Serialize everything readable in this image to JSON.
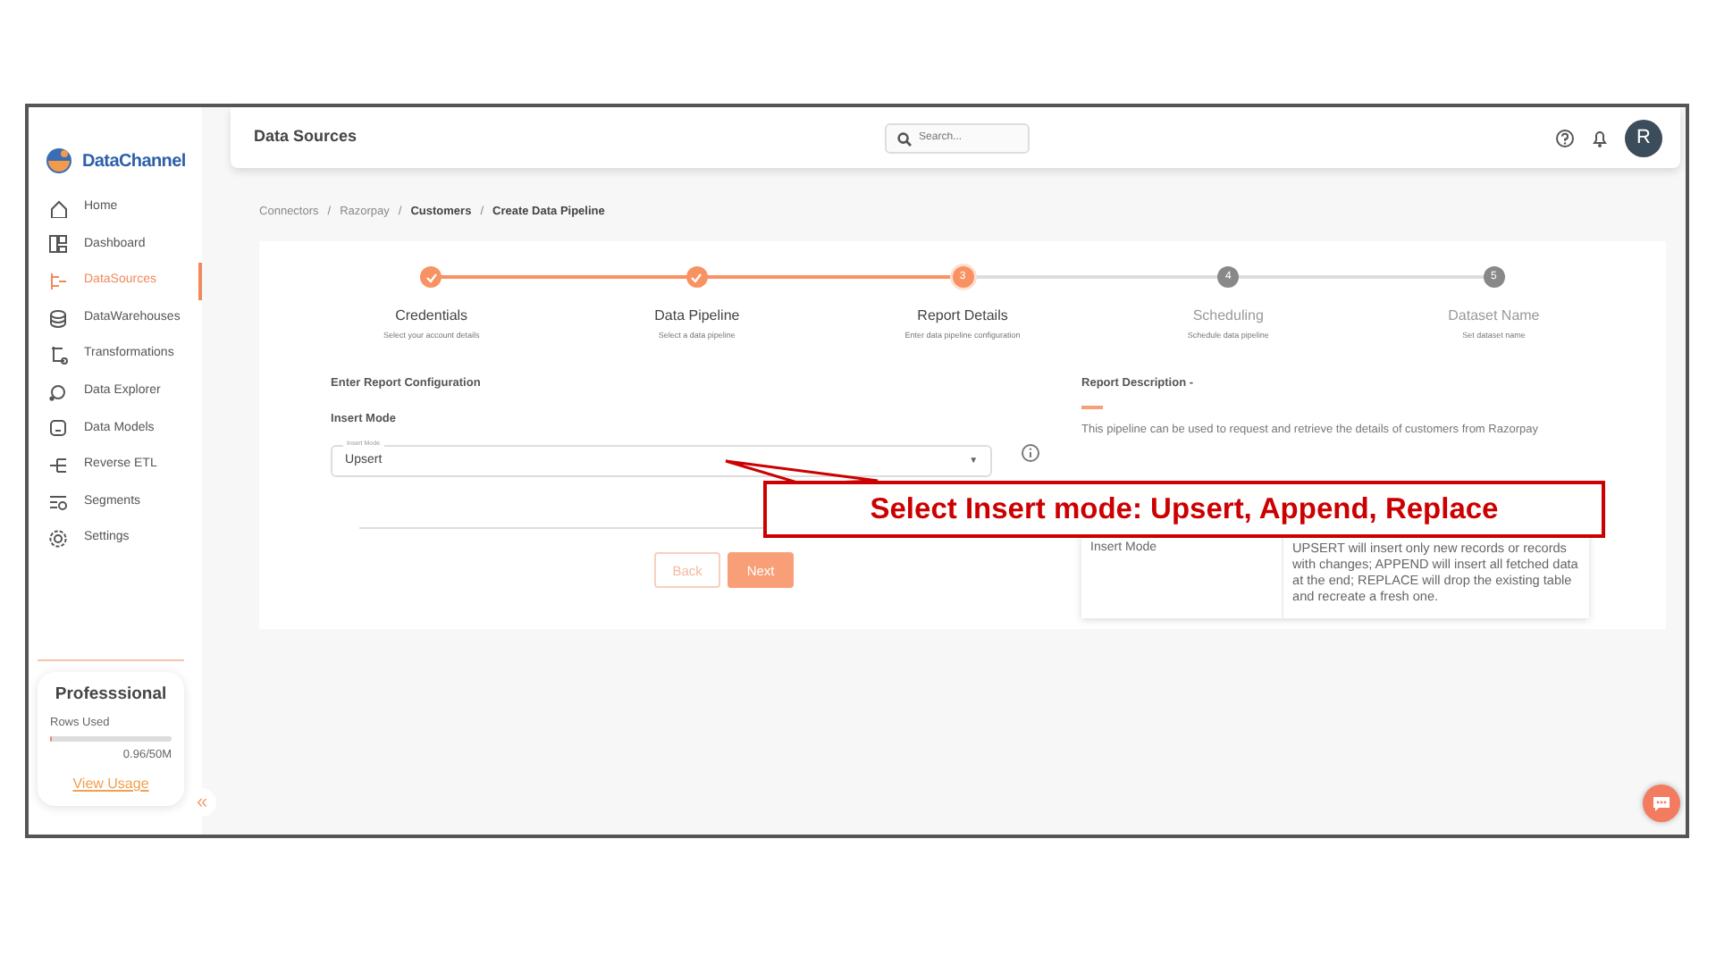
{
  "app": {
    "logo": "DataChannel"
  },
  "sidebar": {
    "items": [
      {
        "label": "Home",
        "selected": false
      },
      {
        "label": "Dashboard",
        "selected": false
      },
      {
        "label": "DataSources",
        "selected": true
      },
      {
        "label": "DataWarehouses",
        "selected": false
      },
      {
        "label": "Transformations",
        "selected": false
      },
      {
        "label": "Data Explorer",
        "selected": false
      },
      {
        "label": "Data Models",
        "selected": false
      },
      {
        "label": "Reverse ETL",
        "selected": false
      },
      {
        "label": "Segments",
        "selected": false
      },
      {
        "label": "Settings",
        "selected": false
      }
    ]
  },
  "plan": {
    "name": "Professsional",
    "rows_label": "Rows Used",
    "level": 0.02,
    "usage": "0.96/50M",
    "link": "View Usage"
  },
  "collapse": "«",
  "header": {
    "title": "Data Sources",
    "search_placeholder": "Search...",
    "avatar": "R"
  },
  "breadcrumb": [
    {
      "label": "Connectors",
      "muted": true
    },
    {
      "separator": "/",
      "muted": true
    },
    {
      "label": "Razorpay",
      "muted": true
    },
    {
      "separator": "/",
      "muted": true
    },
    {
      "label": "Customers",
      "muted": false
    },
    {
      "separator": "/",
      "muted": true
    },
    {
      "label": "Create Data Pipeline",
      "muted": false
    }
  ],
  "steps": [
    {
      "done": true,
      "current": false,
      "title": "Credentials",
      "subtitle": "Select your account details"
    },
    {
      "done": true,
      "current": false,
      "title": "Data Pipeline",
      "subtitle": "Select a data pipeline"
    },
    {
      "done": false,
      "current": true,
      "number": "3",
      "title": "Report Details",
      "subtitle": "Enter data pipeline configuration"
    },
    {
      "done": false,
      "current": false,
      "number": "4",
      "title": "Scheduling",
      "subtitle": "Schedule data pipeline"
    },
    {
      "done": false,
      "current": false,
      "number": "5",
      "title": "Dataset Name",
      "subtitle": "Set dataset name"
    }
  ],
  "form": {
    "heading": "Enter Report Configuration",
    "field_label": "Insert Mode",
    "floating_label": "Insert Mode",
    "value": "Upsert",
    "caret": "▼"
  },
  "buttons": [
    {
      "label": "Back",
      "kind": "outline"
    },
    {
      "label": "Next",
      "kind": "primary"
    }
  ],
  "description": {
    "heading": "Report Description -",
    "text": "This pipeline can be used to request and retrieve the details of customers from Razorpay",
    "table": [
      {
        "name": "Insert Mode",
        "text": "UPSERT will insert only new records or records with changes; APPEND will insert all fetched data at the end; REPLACE will drop the existing table and recreate a fresh one."
      }
    ]
  },
  "annotation": {
    "text": "Select Insert mode: Upsert, Append, Replace"
  }
}
